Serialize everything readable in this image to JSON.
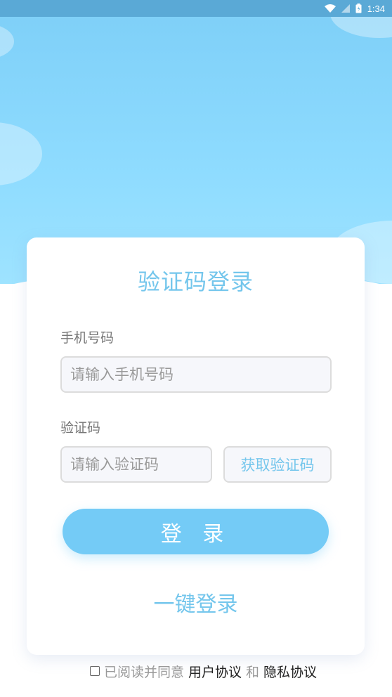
{
  "status_bar": {
    "time": "1:34"
  },
  "login": {
    "title": "验证码登录",
    "phone_label": "手机号码",
    "phone_placeholder": "请输入手机号码",
    "code_label": "验证码",
    "code_placeholder": "请输入验证码",
    "get_code_label": "获取验证码",
    "login_button_label": "登 录",
    "one_key_label": "一键登录"
  },
  "agreement": {
    "prefix": "已阅读并同意",
    "user_agreement": "用户协议",
    "and": "和",
    "privacy_agreement": "隐私协议"
  },
  "colors": {
    "accent": "#74c6ec",
    "button": "#74cbf6",
    "header_bg": "#8fdcff"
  }
}
